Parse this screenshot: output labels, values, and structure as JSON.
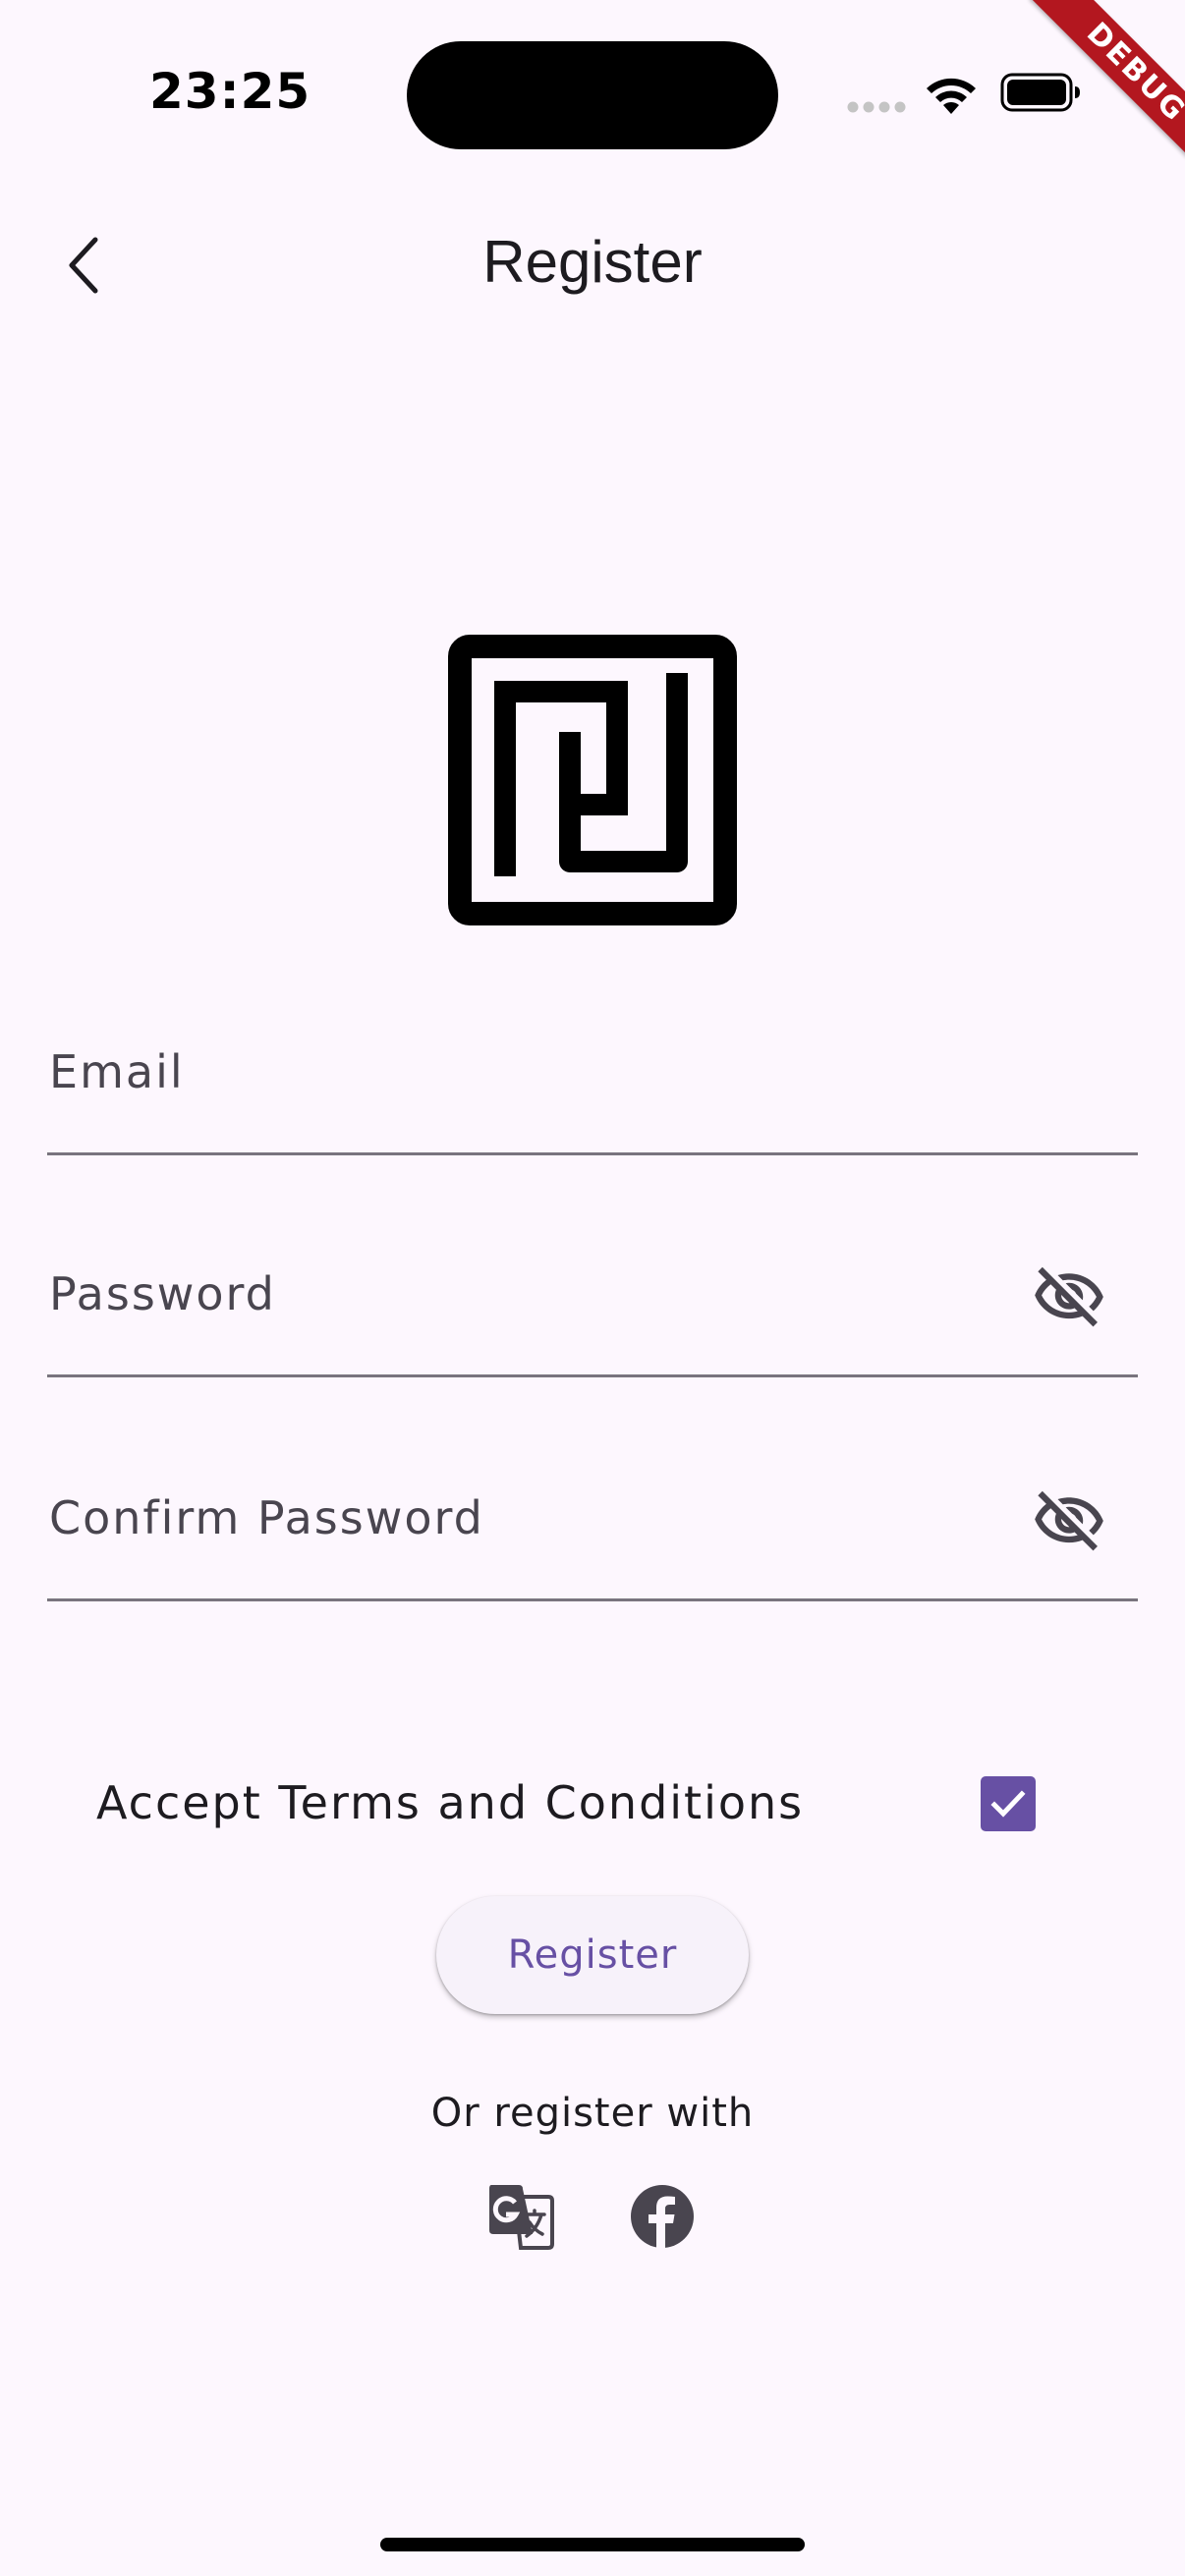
{
  "status_bar": {
    "time": "23:25"
  },
  "debug_banner": {
    "label": "DEBUG",
    "color": "#b3171f"
  },
  "app_bar": {
    "title": "Register",
    "back_icon": "chevron-left-icon"
  },
  "form": {
    "email": {
      "label": "Email",
      "value": ""
    },
    "password": {
      "label": "Password",
      "value": "",
      "visibility_icon": "eye-off-icon"
    },
    "confirm_password": {
      "label": "Confirm Password",
      "value": "",
      "visibility_icon": "eye-off-icon"
    },
    "terms": {
      "label": "Accept Terms and Conditions",
      "checked": true
    },
    "submit_label": "Register"
  },
  "social": {
    "prompt": "Or register with",
    "providers": [
      {
        "icon": "google-translate-icon"
      },
      {
        "icon": "facebook-icon"
      }
    ]
  },
  "colors": {
    "background": "#fdf7fe",
    "primary": "#6750a4",
    "button_surface": "#f7f2fa",
    "field_line": "#79747e",
    "label": "#49454f"
  }
}
